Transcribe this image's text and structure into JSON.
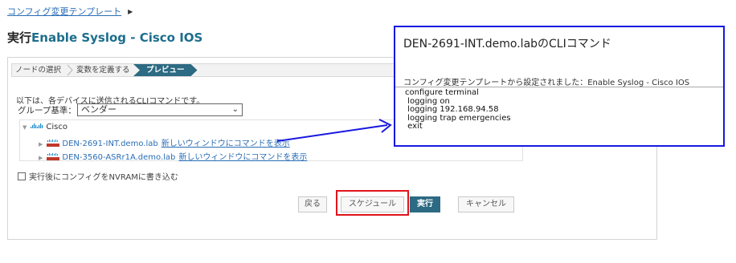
{
  "breadcrumb": {
    "link": "コンフィグ変更テンプレート"
  },
  "title": {
    "prefix": "実行",
    "template_name": "Enable Syslog - Cisco IOS"
  },
  "wizard": {
    "steps": [
      {
        "label": "ノードの選択"
      },
      {
        "label": "変数を定義する"
      },
      {
        "label": "プレビュー"
      }
    ]
  },
  "intro": "以下は、各デバイスに送信されるCLIコマンドです。",
  "group": {
    "label": "グループ基準：",
    "selected": "ベンダー"
  },
  "tree": {
    "vendor": "Cisco",
    "devices": [
      {
        "name": "DEN-2691-INT.demo.lab",
        "link": "新しいウィンドウにコマンドを表示"
      },
      {
        "name": "DEN-3560-ASRr1A.demo.lab",
        "link": "新しいウィンドウにコマンドを表示"
      }
    ]
  },
  "nvram": {
    "label": "実行後にコンフィグをNVRAMに書き込む",
    "checked": false
  },
  "buttons": {
    "back": "戻る",
    "schedule": "スケジュール",
    "execute": "実行",
    "cancel": "キャンセル"
  },
  "callout": {
    "title": "DEN-2691-INT.demo.labのCLIコマンド",
    "subtitle": "コンフィグ変更テンプレートから設定されました：Enable Syslog - Cisco IOS",
    "commands": [
      "configure terminal",
      " logging on",
      " logging 192.168.94.58",
      " logging trap emergencies",
      " exit"
    ]
  },
  "colors": {
    "accent": "#2d6a83",
    "link": "#2a6db5",
    "highlight": "#e0141c",
    "callout_border": "#1818e0"
  }
}
